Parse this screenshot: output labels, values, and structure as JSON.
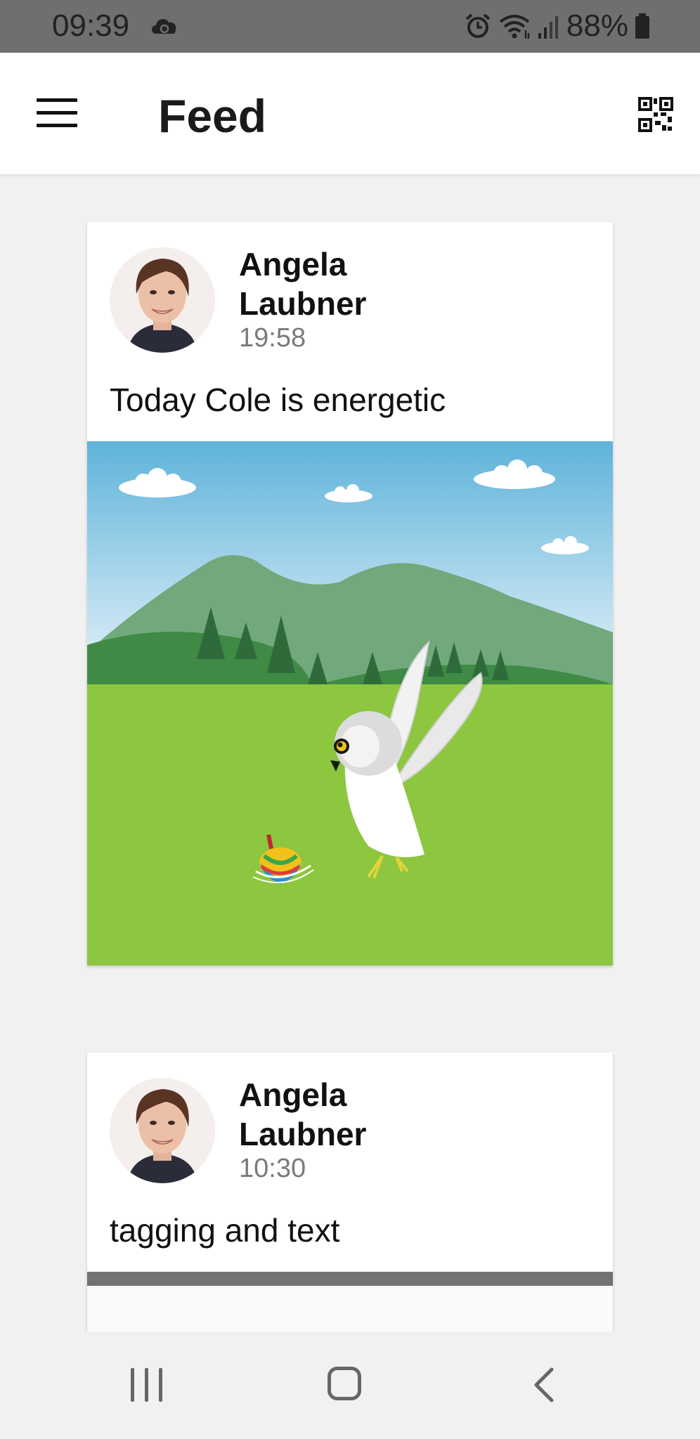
{
  "status_bar": {
    "time": "09:39",
    "battery": "88%",
    "icons": [
      "cloud-sync-icon",
      "alarm-icon",
      "wifi-icon",
      "signal-icon",
      "battery-icon"
    ]
  },
  "app_bar": {
    "title": "Feed",
    "left_icon": "menu-icon",
    "right_icon": "qr-code-icon"
  },
  "feed": {
    "posts": [
      {
        "author": "Angela Laubner",
        "time": "19:58",
        "text": "Today Cole  is energetic",
        "image": "owl-spinning-top-illustration"
      },
      {
        "author": "Angela Laubner",
        "time": "10:30",
        "text": "tagging and text"
      }
    ]
  },
  "nav_bar": {
    "icons": [
      "recents-icon",
      "home-icon",
      "back-icon"
    ]
  },
  "colors": {
    "status_bar": "#6f6f6f",
    "background": "#f1f1f1",
    "sky": "#7cc0e0",
    "grass": "#8dc63f",
    "hills": "#6ca67a"
  }
}
